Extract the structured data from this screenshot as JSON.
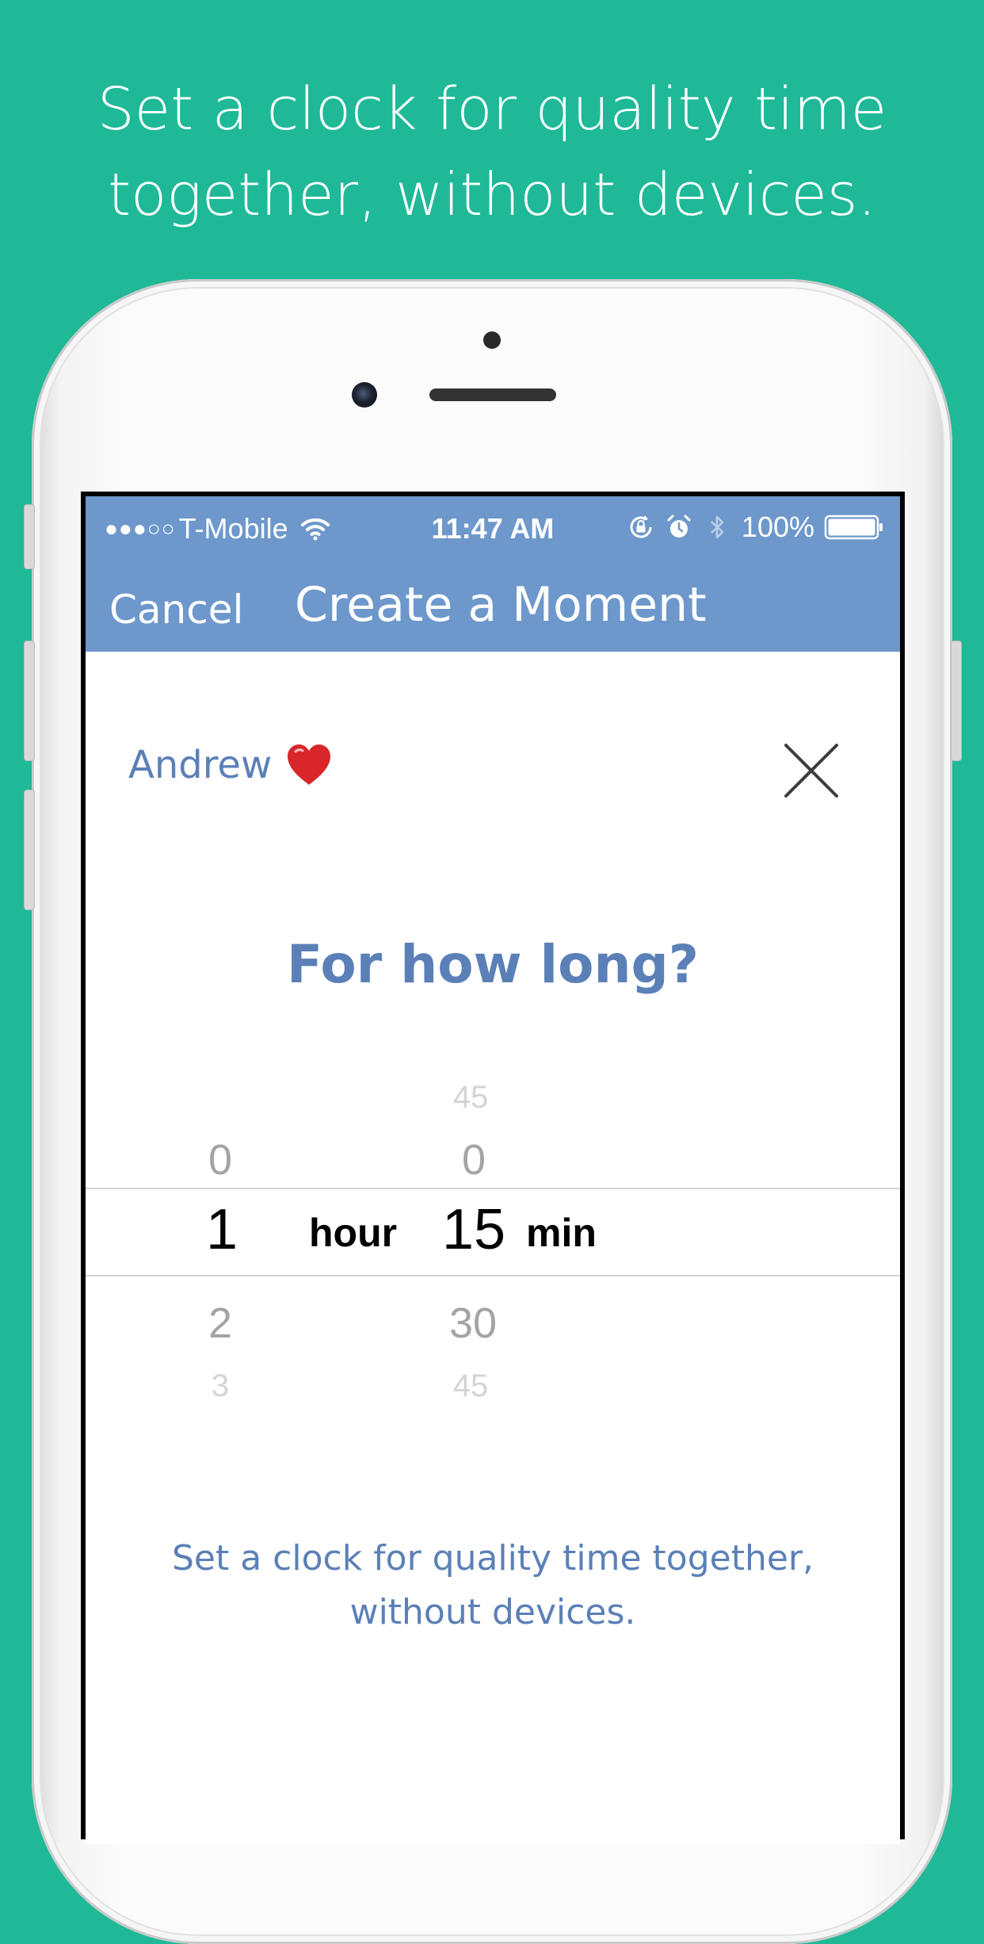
{
  "headline": {
    "line1": "Set a clock for quality time",
    "line2": "together, without devices."
  },
  "status_bar": {
    "signal": "●●●○○",
    "carrier": "T-Mobile",
    "time": "11:47 AM",
    "battery": "100%",
    "icons": [
      "wifi-icon",
      "rotation-lock-icon",
      "alarm-icon",
      "bluetooth-icon",
      "battery-icon"
    ]
  },
  "nav": {
    "cancel_label": "Cancel",
    "title": "Create a Moment"
  },
  "person": {
    "name": "Andrew",
    "emoji_icon": "heart-icon"
  },
  "question": "For how long?",
  "picker": {
    "hours": {
      "above": "0",
      "selected": "1",
      "below": [
        "2",
        "3"
      ],
      "unit": "hour"
    },
    "minutes": {
      "above": [
        "45",
        "0"
      ],
      "selected": "15",
      "below": [
        "30",
        "45"
      ],
      "unit": "min"
    }
  },
  "caption": {
    "line1": "Set a clock for quality time together,",
    "line2": "without devices."
  },
  "colors": {
    "background": "#1fb998",
    "navbar": "#6e98cb",
    "accent_text": "#5b80b7",
    "heart": "#d8262b"
  }
}
